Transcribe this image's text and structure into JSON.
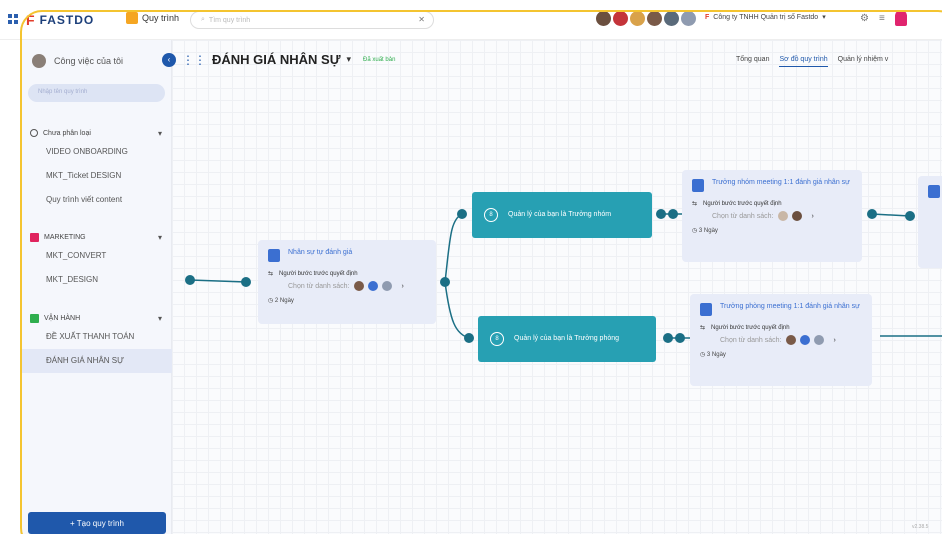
{
  "app": {
    "logo": "FASTDO",
    "module": "Quy trình"
  },
  "search": {
    "placeholder": "Tìm quy trình"
  },
  "company": "Công ty TNHH Quản trị số Fastdo",
  "sidebar": {
    "my_work": "Công việc của tôi",
    "search_placeholder": "Nhập tên quy trình",
    "groups": [
      {
        "label": "Chưa phân loại",
        "color": "#555555",
        "items": [
          "VIDEO ONBOARDING",
          "MKT_Ticket DESIGN",
          "Quy trình viết content"
        ]
      },
      {
        "label": "MARKETING",
        "color": "#e0245e",
        "items": [
          "MKT_CONVERT",
          "MKT_DESIGN"
        ]
      },
      {
        "label": "VẬN HÀNH",
        "color": "#2fae4e",
        "items": [
          "ĐỀ XUẤT THANH TOÁN",
          "ĐÁNH GIÁ NHÂN SỰ"
        ]
      }
    ],
    "active_item": "ĐÁNH GIÁ NHÂN SỰ",
    "new_button": "+ Tạo quy trình"
  },
  "page": {
    "title": "ĐÁNH GIÁ NHÂN SỰ",
    "status": "Đã xuất bản"
  },
  "tabs": [
    "Tổng quan",
    "Sơ đồ quy trình",
    "Quản lý nhiệm v"
  ],
  "active_tab": "Sơ đồ quy trình",
  "nodes": {
    "self_eval": {
      "title": "Nhân sự tự đánh giá",
      "role": "Người bước trước quyết định",
      "choose": "Chọn từ danh sách:",
      "duration": "2 Ngày"
    },
    "manager_team": {
      "title": "Quản lý của bạn là Trưởng nhóm"
    },
    "manager_dept": {
      "title": "Quản lý của bạn là Trưởng phòng"
    },
    "team_meeting": {
      "title": "Trưởng nhóm meeting 1:1 đánh giá nhân sự",
      "role": "Người bước trước quyết định",
      "choose": "Chọn từ danh sách:",
      "duration": "3 Ngày"
    },
    "dept_meeting": {
      "title": "Trưởng phòng meeting 1:1 đánh giá nhân sự",
      "role": "Người bước trước quyết định",
      "choose": "Chọn từ danh sách:",
      "duration": "3 Ngày"
    }
  },
  "version": "v2.38.5",
  "colors": {
    "accent": "#1f58ab",
    "teal": "#27a0b3",
    "node_bg": "#e8ecf8",
    "frame": "#f4c430"
  }
}
